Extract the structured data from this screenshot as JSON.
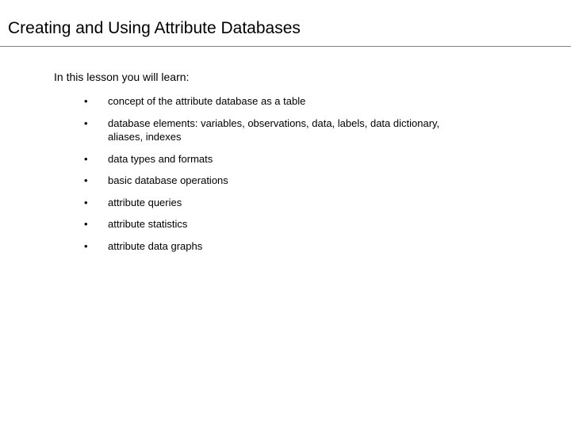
{
  "title": "Creating and Using Attribute Databases",
  "intro": "In this lesson you will learn:",
  "bullets": [
    "concept of the attribute database as a table",
    "database elements: variables, observations, data, labels, data dictionary, aliases, indexes",
    "data types and formats",
    "basic database operations",
    "attribute queries",
    "attribute statistics",
    "attribute data graphs"
  ]
}
